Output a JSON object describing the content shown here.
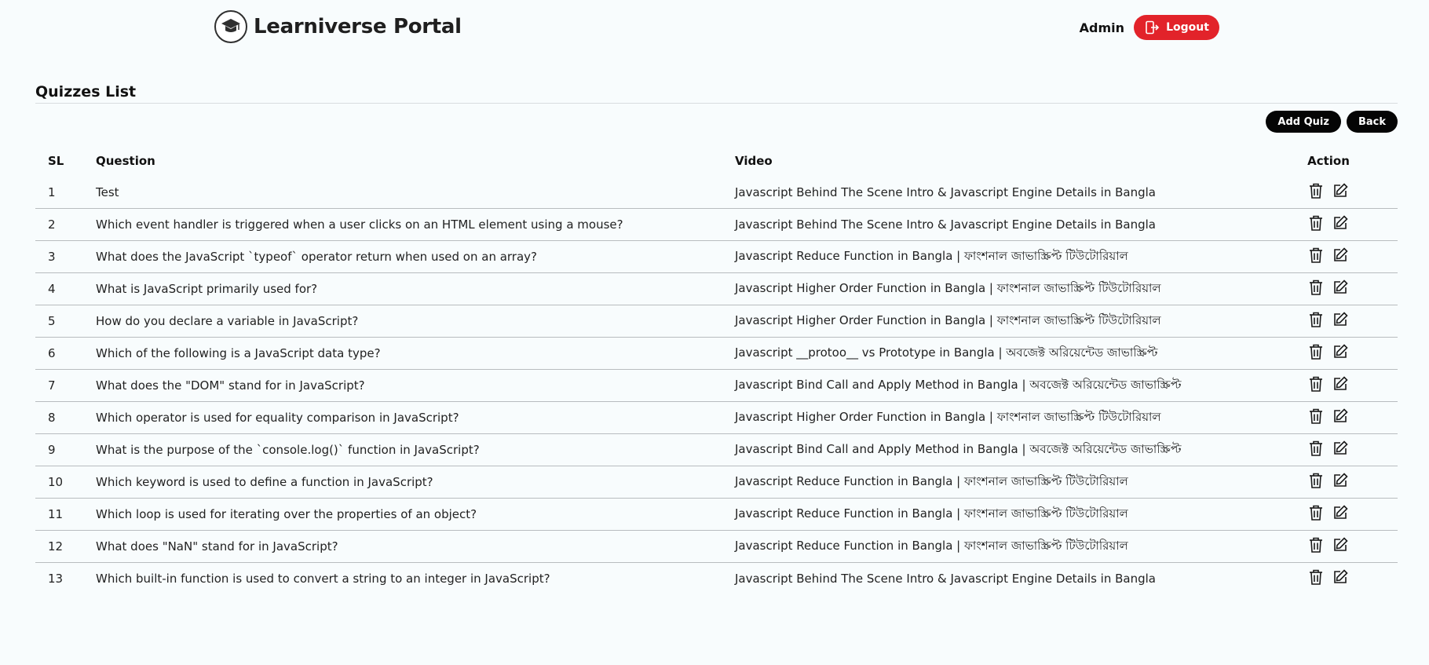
{
  "header": {
    "brand_title": "Learniverse Portal",
    "user_name": "Admin",
    "logout_label": "Logout"
  },
  "page": {
    "title": "Quizzes List",
    "add_quiz_label": "Add Quiz",
    "back_label": "Back"
  },
  "table": {
    "columns": {
      "sl": "SL",
      "question": "Question",
      "video": "Video",
      "action": "Action"
    },
    "rows": [
      {
        "sl": "1",
        "question": "Test",
        "video": "Javascript Behind The Scene Intro & Javascript Engine Details in Bangla"
      },
      {
        "sl": "2",
        "question": "Which event handler is triggered when a user clicks on an HTML element using a mouse?",
        "video": "Javascript Behind The Scene Intro & Javascript Engine Details in Bangla"
      },
      {
        "sl": "3",
        "question": "What does the JavaScript `typeof` operator return when used on an array?",
        "video": "Javascript Reduce Function in Bangla | ফাংশনাল জাভাস্ক্রিপ্ট টিউটোরিয়াল"
      },
      {
        "sl": "4",
        "question": "What is JavaScript primarily used for?",
        "video": "Javascript Higher Order Function in Bangla | ফাংশনাল জাভাস্ক্রিপ্ট টিউটোরিয়াল"
      },
      {
        "sl": "5",
        "question": "How do you declare a variable in JavaScript?",
        "video": "Javascript Higher Order Function in Bangla | ফাংশনাল জাভাস্ক্রিপ্ট টিউটোরিয়াল"
      },
      {
        "sl": "6",
        "question": "Which of the following is a JavaScript data type?",
        "video": "Javascript __protoo__ vs Prototype in Bangla | অবজেক্ট অরিয়েন্টেড জাভাস্ক্রিপ্ট"
      },
      {
        "sl": "7",
        "question": "What does the \"DOM\" stand for in JavaScript?",
        "video": "Javascript Bind Call and Apply Method in Bangla | অবজেক্ট অরিয়েন্টেড জাভাস্ক্রিপ্ট"
      },
      {
        "sl": "8",
        "question": "Which operator is used for equality comparison in JavaScript?",
        "video": "Javascript Higher Order Function in Bangla | ফাংশনাল জাভাস্ক্রিপ্ট টিউটোরিয়াল"
      },
      {
        "sl": "9",
        "question": "What is the purpose of the `console.log()` function in JavaScript?",
        "video": "Javascript Bind Call and Apply Method in Bangla | অবজেক্ট অরিয়েন্টেড জাভাস্ক্রিপ্ট"
      },
      {
        "sl": "10",
        "question": "Which keyword is used to define a function in JavaScript?",
        "video": "Javascript Reduce Function in Bangla | ফাংশনাল জাভাস্ক্রিপ্ট টিউটোরিয়াল"
      },
      {
        "sl": "11",
        "question": "Which loop is used for iterating over the properties of an object?",
        "video": "Javascript Reduce Function in Bangla | ফাংশনাল জাভাস্ক্রিপ্ট টিউটোরিয়াল"
      },
      {
        "sl": "12",
        "question": "What does \"NaN\" stand for in JavaScript?",
        "video": "Javascript Reduce Function in Bangla | ফাংশনাল জাভাস্ক্রিপ্ট টিউটোরিয়াল"
      },
      {
        "sl": "13",
        "question": "Which built-in function is used to convert a string to an integer in JavaScript?",
        "video": "Javascript Behind The Scene Intro & Javascript Engine Details in Bangla"
      }
    ]
  },
  "icons": {
    "brand": "graduation-cap-icon",
    "logout": "logout-icon",
    "delete": "trash-icon",
    "edit": "edit-icon"
  },
  "colors": {
    "logout_bg": "#e2232a",
    "button_bg": "#050505",
    "page_bg": "#f8fcfd"
  }
}
